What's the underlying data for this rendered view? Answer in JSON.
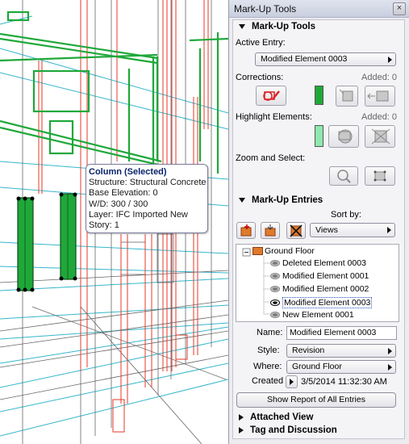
{
  "tooltip": {
    "title": "Column (Selected)",
    "lines": [
      "Structure: Structural Concrete",
      "Base Elevation: 0",
      "W/D: 300 / 300",
      "Layer: IFC Imported New",
      "Story: 1"
    ]
  },
  "palette": {
    "title": "Mark-Up Tools",
    "close_glyph": "×",
    "markup_tools": {
      "header": "Mark-Up Tools",
      "active_entry_label": "Active Entry:",
      "active_entry_value": "Modified Element 0003",
      "corrections_label": "Corrections:",
      "corrections_added": "Added: 0",
      "highlight_label": "Highlight Elements:",
      "highlight_added": "Added: 0",
      "zoom_label": "Zoom and Select:"
    },
    "entries": {
      "header": "Mark-Up Entries",
      "sort_label": "Sort by:",
      "sort_value": "Views",
      "tree_root": "Ground Floor",
      "tree_items": [
        "Deleted Element 0003",
        "Modified Element 0001",
        "Modified Element 0002",
        "Modified Element 0003",
        "New Element 0001"
      ],
      "name_label": "Name:",
      "name_value": "Modified Element 0003",
      "style_label": "Style:",
      "style_value": "Revision",
      "where_label": "Where:",
      "where_value": "Ground Floor",
      "created_label": "Created",
      "created_value": "3/5/2014 11:32:30 AM",
      "report_button": "Show Report of All Entries"
    },
    "attached_view": "Attached View",
    "tag_discussion": "Tag and Discussion"
  },
  "colors": {
    "accent_green": "#1fa83a",
    "structure_red": "#e03a2a",
    "wire_cyan": "#2ab0c8"
  }
}
